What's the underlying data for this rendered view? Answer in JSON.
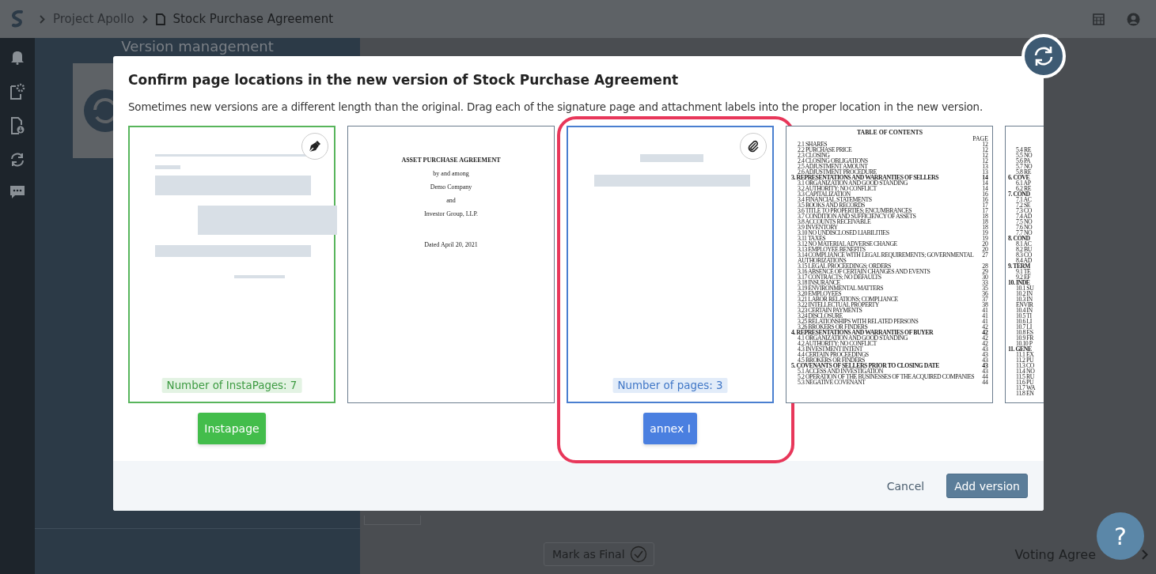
{
  "top_bar": {
    "breadcrumbs": [
      "Project Apollo",
      "Stock Purchase Agreement"
    ]
  },
  "background": {
    "panel_title": "Version management",
    "mark_final": "Mark as Final",
    "next_document": "Voting Agree"
  },
  "dialog": {
    "title": "Confirm page locations in the new version of Stock Purchase Agreement",
    "description": "Sometimes new versions are a different length than the original. Drag each of the signature page and attachment labels into the proper location in the new version.",
    "pages": [
      {
        "kind": "signature",
        "highlighted": false,
        "badge": "Number of InstaPages: 7",
        "label": "Instapage"
      },
      {
        "kind": "cover",
        "highlighted": false,
        "lines": [
          {
            "kind": "title",
            "text": "ASSET PURCHASE AGREEMENT"
          },
          {
            "kind": "line",
            "text": "by and among"
          },
          {
            "kind": "line",
            "text": "Demo Company"
          },
          {
            "kind": "line",
            "text": "and"
          },
          {
            "kind": "line",
            "text": "Investor Group, LLP."
          },
          {
            "kind": "date",
            "text": "Dated April 20, 2021"
          }
        ]
      },
      {
        "kind": "attachment",
        "highlighted": true,
        "badge": "Number of pages: 3",
        "label": "annex I"
      },
      {
        "kind": "toc",
        "highlighted": false,
        "title": "TABLE OF CONTENTS",
        "page_header": "PAGE",
        "entries": [
          {
            "text": "2.1 SHARES",
            "page": "12",
            "heading": false
          },
          {
            "text": "2.2 PURCHASE PRICE",
            "page": "12",
            "heading": false
          },
          {
            "text": "2.3 CLOSING",
            "page": "12",
            "heading": false
          },
          {
            "text": "2.4 CLOSING OBLIGATIONS",
            "page": "12",
            "heading": false
          },
          {
            "text": "2.5 ADJUSTMENT AMOUNT",
            "page": "13",
            "heading": false
          },
          {
            "text": "2.6 ADJUSTMENT PROCEDURE",
            "page": "13",
            "heading": false
          },
          {
            "text": "3. REPRESENTATIONS AND WARRANTIES OF SELLERS",
            "page": "14",
            "heading": true
          },
          {
            "text": "3.1 ORGANIZATION AND GOOD STANDING",
            "page": "14",
            "heading": false
          },
          {
            "text": "3.2 AUTHORITY; NO CONFLICT",
            "page": "14",
            "heading": false
          },
          {
            "text": "3.3 CAPITALIZATION",
            "page": "16",
            "heading": false
          },
          {
            "text": "3.4 FINANCIAL STATEMENTS",
            "page": "16",
            "heading": false
          },
          {
            "text": "3.5 BOOKS AND RECORDS",
            "page": "17",
            "heading": false
          },
          {
            "text": "3.6 TITLE TO PROPERTIES; ENCUMBRANCES",
            "page": "17",
            "heading": false
          },
          {
            "text": "3.7 CONDITION AND SUFFICIENCY OF ASSETS",
            "page": "18",
            "heading": false
          },
          {
            "text": "3.8 ACCOUNTS RECEIVABLE",
            "page": "18",
            "heading": false
          },
          {
            "text": "3.9 INVENTORY",
            "page": "18",
            "heading": false
          },
          {
            "text": "3.10 NO UNDISCLOSED LIABILITIES",
            "page": "19",
            "heading": false
          },
          {
            "text": "3.11 TAXES",
            "page": "19",
            "heading": false
          },
          {
            "text": "3.12 NO MATERIAL ADVERSE CHANGE",
            "page": "20",
            "heading": false
          },
          {
            "text": "3.13 EMPLOYEE BENEFITS",
            "page": "20",
            "heading": false
          },
          {
            "text": "3.14 COMPLIANCE WITH LEGAL REQUIREMENTS; GOVERNMENTAL AUTHORIZATIONS",
            "page": "27",
            "heading": false
          },
          {
            "text": "3.15 LEGAL PROCEEDINGS; ORDERS",
            "page": "28",
            "heading": false
          },
          {
            "text": "3.16 ABSENCE OF CERTAIN CHANGES AND EVENTS",
            "page": "29",
            "heading": false
          },
          {
            "text": "3.17 CONTRACTS; NO DEFAULTS",
            "page": "30",
            "heading": false
          },
          {
            "text": "3.18 INSURANCE",
            "page": "33",
            "heading": false
          },
          {
            "text": "3.19 ENVIRONMENTAL MATTERS",
            "page": "35",
            "heading": false
          },
          {
            "text": "3.20 EMPLOYEES",
            "page": "36",
            "heading": false
          },
          {
            "text": "3.21 LABOR RELATIONS; COMPLIANCE",
            "page": "37",
            "heading": false
          },
          {
            "text": "3.22 INTELLECTUAL PROPERTY",
            "page": "38",
            "heading": false
          },
          {
            "text": "3.23 CERTAIN PAYMENTS",
            "page": "41",
            "heading": false
          },
          {
            "text": "3.24 DISCLOSURE",
            "page": "41",
            "heading": false
          },
          {
            "text": "3.25 RELATIONSHIPS WITH RELATED PERSONS",
            "page": "41",
            "heading": false
          },
          {
            "text": "3.26 BROKERS OR FINDERS",
            "page": "42",
            "heading": false
          },
          {
            "text": "4. REPRESENTATIONS AND WARRANTIES OF BUYER",
            "page": "42",
            "heading": true
          },
          {
            "text": "4.1 ORGANIZATION AND GOOD STANDING",
            "page": "42",
            "heading": false
          },
          {
            "text": "4.2 AUTHORITY; NO CONFLICT",
            "page": "42",
            "heading": false
          },
          {
            "text": "4.3 INVESTMENT INTENT",
            "page": "43",
            "heading": false
          },
          {
            "text": "4.4 CERTAIN PROCEEDINGS",
            "page": "43",
            "heading": false
          },
          {
            "text": "4.5 BROKERS OR FINDERS",
            "page": "43",
            "heading": false
          },
          {
            "text": "5. COVENANTS OF SELLERS PRIOR TO CLOSING DATE",
            "page": "43",
            "heading": true
          },
          {
            "text": "5.1 ACCESS AND INVESTIGATION",
            "page": "43",
            "heading": false
          },
          {
            "text": "5.2 OPERATION OF THE BUSINESSES OF THE ACQUIRED COMPANIES",
            "page": "44",
            "heading": false
          },
          {
            "text": "5.3 NEGATIVE COVENANT",
            "page": "44",
            "heading": false
          }
        ]
      },
      {
        "kind": "toc_partial",
        "highlighted": false,
        "entries": [
          {
            "text": "5.4 RE",
            "heading": false
          },
          {
            "text": "5.5 NO",
            "heading": false
          },
          {
            "text": "5.6 PA",
            "heading": false
          },
          {
            "text": "5.7 NO",
            "heading": false
          },
          {
            "text": "5.8 RE",
            "heading": false
          },
          {
            "text": "6. COVE",
            "heading": true
          },
          {
            "text": "6.1 AP",
            "heading": false
          },
          {
            "text": "6.2 RE",
            "heading": false
          },
          {
            "text": "7. COND",
            "heading": true
          },
          {
            "text": "7.1 AC",
            "heading": false
          },
          {
            "text": "7.2 SE",
            "heading": false
          },
          {
            "text": "7.3 CO",
            "heading": false
          },
          {
            "text": "7.4 AD",
            "heading": false
          },
          {
            "text": "7.5 NO",
            "heading": false
          },
          {
            "text": "7.6 NO",
            "heading": false
          },
          {
            "text": "7.7 NO",
            "heading": false
          },
          {
            "text": "8. COND",
            "heading": true
          },
          {
            "text": "8.1 AC",
            "heading": false
          },
          {
            "text": "8.2 BU",
            "heading": false
          },
          {
            "text": "8.3 CO",
            "heading": false
          },
          {
            "text": "8.4 AD",
            "heading": false
          },
          {
            "text": "9. TERM",
            "heading": true
          },
          {
            "text": "9.1 TE",
            "heading": false
          },
          {
            "text": "9.2 EF",
            "heading": false
          },
          {
            "text": "10. INDE",
            "heading": true
          },
          {
            "text": "10.1 SU",
            "heading": false
          },
          {
            "text": "10.2 IN",
            "heading": false
          },
          {
            "text": "10.3 IN",
            "heading": false
          },
          {
            "text": "ENVIR",
            "heading": false
          },
          {
            "text": "10.4 IN",
            "heading": false
          },
          {
            "text": "10.5 TI",
            "heading": false
          },
          {
            "text": "10.6 LI",
            "heading": false
          },
          {
            "text": "10.7 LI",
            "heading": false
          },
          {
            "text": "10.8 ES",
            "heading": false
          },
          {
            "text": "10.9 FR",
            "heading": false
          },
          {
            "text": "10.10 P",
            "heading": false
          },
          {
            "text": "11. GENE",
            "heading": true
          },
          {
            "text": "11.1 EX",
            "heading": false
          },
          {
            "text": "11.2 PU",
            "heading": false
          },
          {
            "text": "11.3 CO",
            "heading": false
          },
          {
            "text": "11.4 NO",
            "heading": false
          },
          {
            "text": "11.5 RU",
            "heading": false
          },
          {
            "text": "11.6 PU",
            "heading": false
          },
          {
            "text": "11.7 WA",
            "heading": false
          },
          {
            "text": "11.8 EN",
            "heading": false
          }
        ]
      }
    ],
    "buttons": {
      "cancel": "Cancel",
      "confirm": "Add version"
    }
  },
  "help_button": "?"
}
